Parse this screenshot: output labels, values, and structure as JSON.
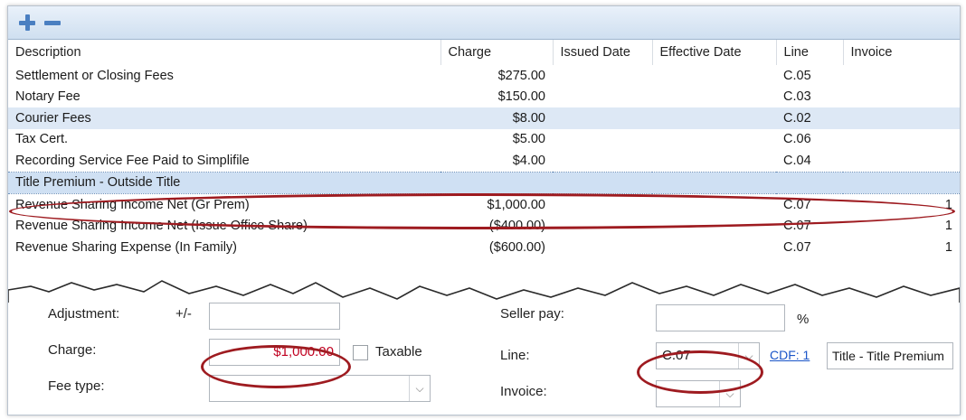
{
  "toolbar": {
    "add_icon": "plus-icon",
    "remove_icon": "minus-icon"
  },
  "grid": {
    "columns": [
      "Description",
      "Charge",
      "Issued Date",
      "Effective Date",
      "Line",
      "Invoice"
    ],
    "rows": [
      {
        "description": "Settlement or Closing Fees",
        "charge": "$275.00",
        "issued": "",
        "effective": "",
        "line": "C.05",
        "invoice": ""
      },
      {
        "description": "Notary Fee",
        "charge": "$150.00",
        "issued": "",
        "effective": "",
        "line": "C.03",
        "invoice": ""
      },
      {
        "description": "Courier Fees",
        "charge": "$8.00",
        "issued": "",
        "effective": "",
        "line": "C.02",
        "invoice": ""
      },
      {
        "description": "Tax Cert.",
        "charge": "$5.00",
        "issued": "",
        "effective": "",
        "line": "C.06",
        "invoice": ""
      },
      {
        "description": "Recording Service Fee Paid to Simplifile",
        "charge": "$4.00",
        "issued": "",
        "effective": "",
        "line": "C.04",
        "invoice": ""
      },
      {
        "description": "Title Premium - Outside Title",
        "charge": "",
        "issued": "",
        "effective": "",
        "line": "",
        "invoice": ""
      },
      {
        "description": "Revenue Sharing Income Net (Gr Prem)",
        "charge": "$1,000.00",
        "issued": "",
        "effective": "",
        "line": "C.07",
        "invoice": "1"
      },
      {
        "description": "Revenue Sharing Income Net (Issue Office Share)",
        "charge": "($400.00)",
        "issued": "",
        "effective": "",
        "line": "C.07",
        "invoice": "1"
      },
      {
        "description": "Revenue Sharing Expense (In Family)",
        "charge": "($600.00)",
        "issued": "",
        "effective": "",
        "line": "C.07",
        "invoice": "1"
      }
    ]
  },
  "form": {
    "adjustment_label": "Adjustment:",
    "plusminus_label": "+/-",
    "adjustment_value": "",
    "charge_label": "Charge:",
    "charge_value": "$1,000.00",
    "taxable_label": "Taxable",
    "fee_type_label": "Fee type:",
    "fee_type_value": "",
    "seller_pay_label": "Seller pay:",
    "seller_pay_value": "",
    "percent_label": "%",
    "line_label": "Line:",
    "line_value": "C.07",
    "cdf_link": "CDF: 1",
    "cdf_description": "Title - Title Premium",
    "invoice_label": "Invoice:",
    "invoice_value": ""
  },
  "colors": {
    "highlight_ring": "#9e1b20",
    "charge_text": "#c00020",
    "selected_row": "#dde8f5"
  }
}
